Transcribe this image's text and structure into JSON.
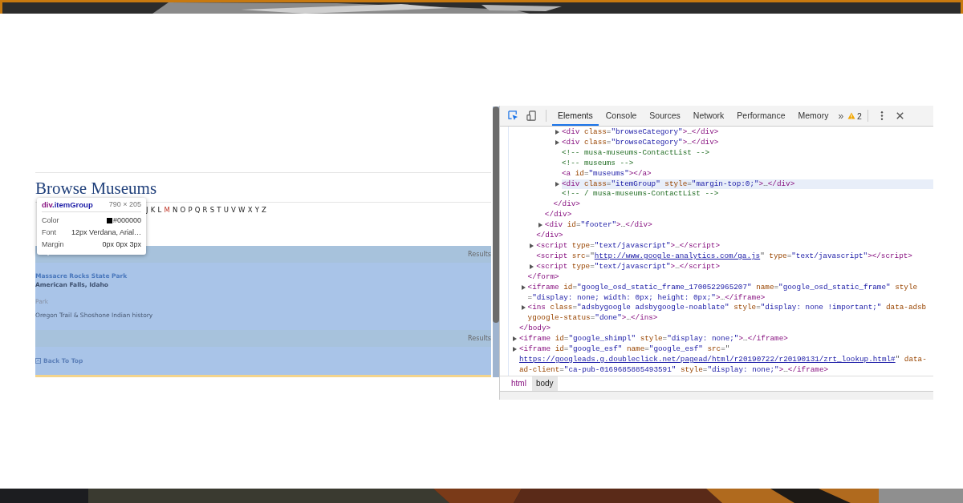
{
  "page": {
    "heading": "Browse Museums",
    "alphabet": [
      {
        "letter": "J",
        "selected": false
      },
      {
        "letter": "K",
        "selected": false
      },
      {
        "letter": "L",
        "selected": false
      },
      {
        "letter": "M",
        "selected": true
      },
      {
        "letter": "N",
        "selected": false
      },
      {
        "letter": "O",
        "selected": false
      },
      {
        "letter": "P",
        "selected": false
      },
      {
        "letter": "Q",
        "selected": false
      },
      {
        "letter": "R",
        "selected": false
      },
      {
        "letter": "S",
        "selected": false
      },
      {
        "letter": "T",
        "selected": false
      },
      {
        "letter": "U",
        "selected": false
      },
      {
        "letter": "V",
        "selected": false
      },
      {
        "letter": "W",
        "selected": false
      },
      {
        "letter": "X",
        "selected": false
      },
      {
        "letter": "Y",
        "selected": false
      },
      {
        "letter": "Z",
        "selected": false
      }
    ],
    "tooltip": {
      "tag": "div",
      "class_name": ".itemGroup",
      "size": "790 × 205",
      "rows": [
        {
          "label": "Color",
          "value": "#000000",
          "color": "#000000"
        },
        {
          "label": "Font",
          "value": "12px Verdana, Arial…"
        },
        {
          "label": "Margin",
          "value": "0px 0px 3px"
        }
      ]
    },
    "results_label": "Results",
    "listing": {
      "name": "Massacre Rocks State Park",
      "location": "American Falls, Idaho",
      "type": "Park",
      "description": "Oregon Trail & Shoshone Indian history"
    },
    "results_label_bottom": "Results",
    "back_to_top": "Back To Top"
  },
  "devtools": {
    "tabs": [
      {
        "label": "Elements",
        "selected": true
      },
      {
        "label": "Console",
        "selected": false
      },
      {
        "label": "Sources",
        "selected": false
      },
      {
        "label": "Network",
        "selected": false
      },
      {
        "label": "Performance",
        "selected": false
      },
      {
        "label": "Memory",
        "selected": false
      }
    ],
    "overflow": "»",
    "warnings": "2",
    "dom_tree": [
      {
        "selected": false,
        "children": [
          {
            "selected": false,
            "children": [
              {
                "selected": false,
                "children": [
                  {
                    "selected": false,
                    "children": [
                      {
                        "selected": false,
                        "children": [
                          {
                            "collapsed": true,
                            "selected": false,
                            "tokens": [
                              {
                                "kind": "tag",
                                "text": "<div"
                              },
                              {
                                "kind": "attr",
                                "text": " class"
                              },
                              {
                                "kind": "punct",
                                "text": "="
                              },
                              {
                                "kind": "value",
                                "text": "\"browseCategory\""
                              },
                              {
                                "kind": "tag",
                                "text": ">"
                              },
                              {
                                "kind": "punct",
                                "text": "…"
                              },
                              {
                                "kind": "tag",
                                "text": "</div>"
                              }
                            ]
                          },
                          {
                            "collapsed": true,
                            "selected": false,
                            "tokens": [
                              {
                                "kind": "tag",
                                "text": "<div"
                              },
                              {
                                "kind": "attr",
                                "text": " class"
                              },
                              {
                                "kind": "punct",
                                "text": "="
                              },
                              {
                                "kind": "value",
                                "text": "\"browseCategory\""
                              },
                              {
                                "kind": "tag",
                                "text": ">"
                              },
                              {
                                "kind": "punct",
                                "text": "…"
                              },
                              {
                                "kind": "tag",
                                "text": "</div>"
                              }
                            ]
                          },
                          {
                            "collapsed": false,
                            "selected": false,
                            "tokens": [
                              {
                                "kind": "comment",
                                "text": "<!-- musa-museums-ContactList -->"
                              }
                            ]
                          },
                          {
                            "collapsed": false,
                            "selected": false,
                            "tokens": [
                              {
                                "kind": "comment",
                                "text": "<!-- museums -->"
                              }
                            ]
                          },
                          {
                            "collapsed": false,
                            "selected": false,
                            "tokens": [
                              {
                                "kind": "tag",
                                "text": "<a"
                              },
                              {
                                "kind": "attr",
                                "text": " id"
                              },
                              {
                                "kind": "punct",
                                "text": "="
                              },
                              {
                                "kind": "value",
                                "text": "\"museums\""
                              },
                              {
                                "kind": "tag",
                                "text": "></a>"
                              }
                            ]
                          },
                          {
                            "collapsed": true,
                            "selected": true,
                            "tokens": [
                              {
                                "kind": "tag",
                                "text": "<div"
                              },
                              {
                                "kind": "attr",
                                "text": " class"
                              },
                              {
                                "kind": "punct",
                                "text": "="
                              },
                              {
                                "kind": "value",
                                "text": "\"itemGroup\""
                              },
                              {
                                "kind": "attr",
                                "text": " style"
                              },
                              {
                                "kind": "punct",
                                "text": "="
                              },
                              {
                                "kind": "value",
                                "text": "\"margin-top:0;\""
                              },
                              {
                                "kind": "tag",
                                "text": ">"
                              },
                              {
                                "kind": "punct",
                                "text": "…"
                              },
                              {
                                "kind": "tag",
                                "text": "</div>"
                              }
                            ]
                          },
                          {
                            "collapsed": false,
                            "selected": false,
                            "tokens": [
                              {
                                "kind": "comment",
                                "text": "<!-- / musa-museums-ContactList -->"
                              }
                            ]
                          }
                        ],
                        "close": [
                          {
                            "kind": "tag",
                            "text": "</div>"
                          }
                        ]
                      }
                    ],
                    "close": [
                      {
                        "kind": "tag",
                        "text": "</div>"
                      }
                    ]
                  },
                  {
                    "collapsed": true,
                    "selected": false,
                    "tokens": [
                      {
                        "kind": "tag",
                        "text": "<div"
                      },
                      {
                        "kind": "attr",
                        "text": " id"
                      },
                      {
                        "kind": "punct",
                        "text": "="
                      },
                      {
                        "kind": "value",
                        "text": "\"footer\""
                      },
                      {
                        "kind": "tag",
                        "text": ">"
                      },
                      {
                        "kind": "punct",
                        "text": "…"
                      },
                      {
                        "kind": "tag",
                        "text": "</div>"
                      }
                    ]
                  }
                ],
                "close": [
                  {
                    "kind": "tag",
                    "text": "</div>"
                  }
                ]
              },
              {
                "collapsed": true,
                "selected": false,
                "tokens": [
                  {
                    "kind": "tag",
                    "text": "<script"
                  },
                  {
                    "kind": "attr",
                    "text": " type"
                  },
                  {
                    "kind": "punct",
                    "text": "="
                  },
                  {
                    "kind": "value",
                    "text": "\"text/javascript\""
                  },
                  {
                    "kind": "tag",
                    "text": ">"
                  },
                  {
                    "kind": "punct",
                    "text": "…"
                  },
                  {
                    "kind": "tag",
                    "text": "</script>"
                  }
                ]
              },
              {
                "collapsed": false,
                "selected": false,
                "tokens": [
                  {
                    "kind": "tag",
                    "text": "<script"
                  },
                  {
                    "kind": "attr",
                    "text": " src"
                  },
                  {
                    "kind": "punct",
                    "text": "=\""
                  },
                  {
                    "kind": "link",
                    "text": "http://www.google-analytics.com/ga.js"
                  },
                  {
                    "kind": "punct",
                    "text": "\""
                  },
                  {
                    "kind": "attr",
                    "text": " type"
                  },
                  {
                    "kind": "punct",
                    "text": "="
                  },
                  {
                    "kind": "value",
                    "text": "\"text/javascript\""
                  },
                  {
                    "kind": "tag",
                    "text": "></script>"
                  }
                ]
              },
              {
                "collapsed": true,
                "selected": false,
                "tokens": [
                  {
                    "kind": "tag",
                    "text": "<script"
                  },
                  {
                    "kind": "attr",
                    "text": " type"
                  },
                  {
                    "kind": "punct",
                    "text": "="
                  },
                  {
                    "kind": "value",
                    "text": "\"text/javascript\""
                  },
                  {
                    "kind": "tag",
                    "text": ">"
                  },
                  {
                    "kind": "punct",
                    "text": "…"
                  },
                  {
                    "kind": "tag",
                    "text": "</script>"
                  }
                ]
              }
            ],
            "close": [
              {
                "kind": "tag",
                "text": "</form>"
              }
            ]
          },
          {
            "collapsed": true,
            "selected": false,
            "tokens": [
              {
                "kind": "tag",
                "text": "<iframe"
              },
              {
                "kind": "attr",
                "text": " id"
              },
              {
                "kind": "punct",
                "text": "="
              },
              {
                "kind": "value",
                "text": "\"google_osd_static_frame_1700522965207\""
              },
              {
                "kind": "attr",
                "text": " name"
              },
              {
                "kind": "punct",
                "text": "="
              },
              {
                "kind": "value",
                "text": "\"google_osd_static_frame\""
              },
              {
                "kind": "attr",
                "text": " style"
              },
              {
                "kind": "punct",
                "text": "="
              },
              {
                "kind": "value",
                "text": "\"display: none; width: 0px; height: 0px;\""
              },
              {
                "kind": "tag",
                "text": ">"
              },
              {
                "kind": "punct",
                "text": "…"
              },
              {
                "kind": "tag",
                "text": "</iframe>"
              }
            ]
          },
          {
            "collapsed": true,
            "selected": false,
            "tokens": [
              {
                "kind": "tag",
                "text": "<ins"
              },
              {
                "kind": "attr",
                "text": " class"
              },
              {
                "kind": "punct",
                "text": "="
              },
              {
                "kind": "value",
                "text": "\"adsbygoogle adsbygoogle-noablate\""
              },
              {
                "kind": "attr",
                "text": " style"
              },
              {
                "kind": "punct",
                "text": "="
              },
              {
                "kind": "value",
                "text": "\"display: none !important;\""
              },
              {
                "kind": "attr",
                "text": " data-adsbygoogle-status"
              },
              {
                "kind": "punct",
                "text": "="
              },
              {
                "kind": "value",
                "text": "\"done\""
              },
              {
                "kind": "tag",
                "text": ">"
              },
              {
                "kind": "punct",
                "text": "…"
              },
              {
                "kind": "tag",
                "text": "</ins>"
              }
            ]
          }
        ],
        "close": [
          {
            "kind": "tag",
            "text": "</body>"
          }
        ]
      },
      {
        "collapsed": true,
        "selected": false,
        "tokens": [
          {
            "kind": "tag",
            "text": "<iframe"
          },
          {
            "kind": "attr",
            "text": " id"
          },
          {
            "kind": "punct",
            "text": "="
          },
          {
            "kind": "value",
            "text": "\"google_shimpl\""
          },
          {
            "kind": "attr",
            "text": " style"
          },
          {
            "kind": "punct",
            "text": "="
          },
          {
            "kind": "value",
            "text": "\"display: none;\""
          },
          {
            "kind": "tag",
            "text": ">"
          },
          {
            "kind": "punct",
            "text": "…"
          },
          {
            "kind": "tag",
            "text": "</iframe>"
          }
        ]
      },
      {
        "collapsed": true,
        "selected": false,
        "tokens": [
          {
            "kind": "tag",
            "text": "<iframe"
          },
          {
            "kind": "attr",
            "text": " id"
          },
          {
            "kind": "punct",
            "text": "="
          },
          {
            "kind": "value",
            "text": "\"google_esf\""
          },
          {
            "kind": "attr",
            "text": " name"
          },
          {
            "kind": "punct",
            "text": "="
          },
          {
            "kind": "value",
            "text": "\"google_esf\""
          },
          {
            "kind": "attr",
            "text": " src"
          },
          {
            "kind": "punct",
            "text": "=\""
          },
          {
            "kind": "link",
            "text": "https://googleads.g.doubleclick.net/pagead/html/r20190722/r20190131/zrt_lookup.html#"
          },
          {
            "kind": "punct",
            "text": "\""
          },
          {
            "kind": "attr",
            "text": " data-ad-client"
          },
          {
            "kind": "punct",
            "text": "="
          },
          {
            "kind": "value",
            "text": "\"ca-pub-0169685885493591\""
          },
          {
            "kind": "attr",
            "text": " style"
          },
          {
            "kind": "punct",
            "text": "="
          },
          {
            "kind": "value",
            "text": "\"display: none;\""
          },
          {
            "kind": "tag",
            "text": ">"
          },
          {
            "kind": "punct",
            "text": "…"
          },
          {
            "kind": "tag",
            "text": "</iframe>"
          }
        ]
      }
    ],
    "breadcrumbs": [
      {
        "label": "html",
        "selected": false
      },
      {
        "label": "body",
        "selected": true
      }
    ]
  }
}
